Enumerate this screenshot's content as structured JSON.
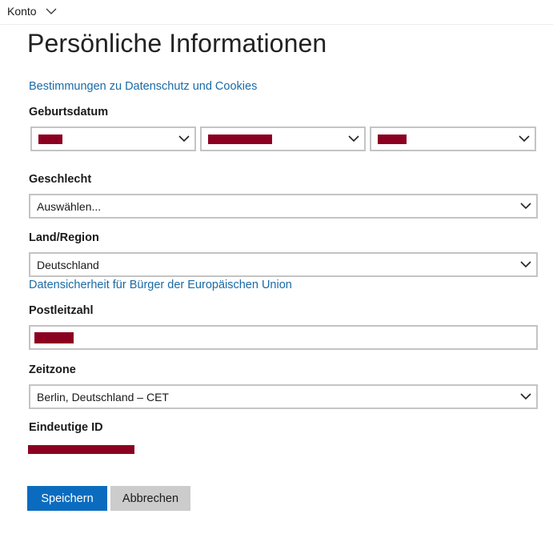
{
  "header": {
    "account_label": "Konto"
  },
  "page": {
    "title": "Persönliche Informationen",
    "privacy_link": "Bestimmungen zu Datenschutz und Cookies"
  },
  "birthdate": {
    "label": "Geburtsdatum"
  },
  "gender": {
    "label": "Geschlecht",
    "selected": "Auswählen..."
  },
  "country": {
    "label": "Land/Region",
    "selected": "Deutschland",
    "eu_link": "Datensicherheit für Bürger der Europäischen Union"
  },
  "postal": {
    "label": "Postleitzahl"
  },
  "timezone": {
    "label": "Zeitzone",
    "selected": "Berlin, Deutschland – CET"
  },
  "unique_id": {
    "label": "Eindeutige ID"
  },
  "actions": {
    "save_label": "Speichern",
    "cancel_label": "Abbrechen"
  },
  "colors": {
    "accent": "#0b6cbf",
    "link": "#1a6aa6",
    "redaction": "#8b0020",
    "border": "#c4c4c4",
    "secondary_button": "#cccccc"
  },
  "icons": {
    "account_menu": "chevron-down-icon",
    "select": "chevron-down-icon"
  }
}
